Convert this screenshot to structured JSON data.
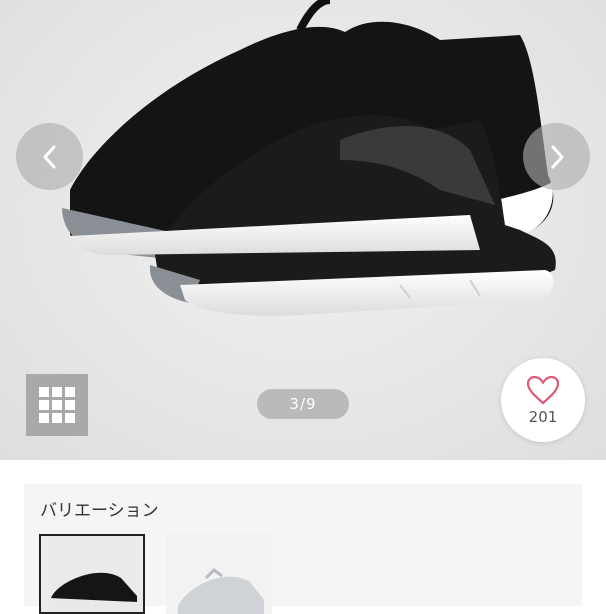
{
  "gallery": {
    "page_counter": "3/9",
    "favorite_count": "201",
    "icons": {
      "prev": "chevron-left-icon",
      "next": "chevron-right-icon",
      "grid": "grid-icon",
      "favorite": "heart-icon"
    },
    "colors": {
      "heart": "#e05a78",
      "arrow_bg": "#acacac",
      "counter_bg": "#969696"
    }
  },
  "variation": {
    "title": "バリエーション",
    "items": [
      {
        "color": "black",
        "selected": true
      },
      {
        "color": "white",
        "selected": false
      }
    ]
  }
}
